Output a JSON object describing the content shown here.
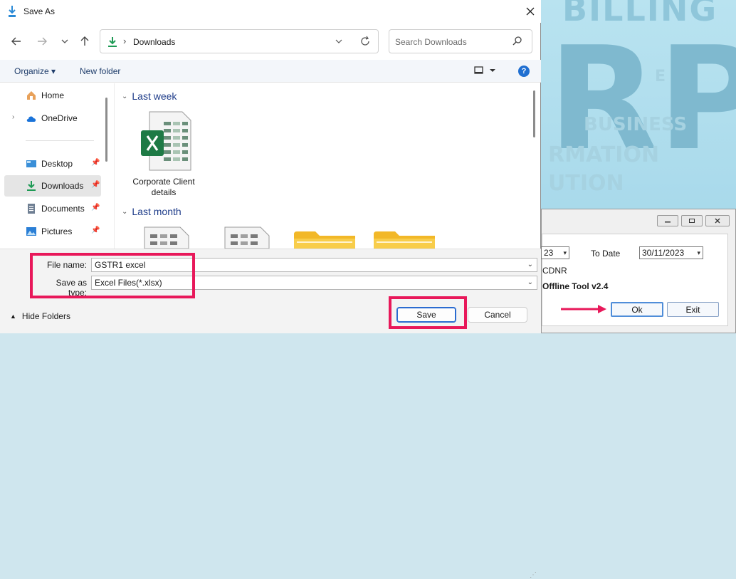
{
  "dialog": {
    "title": "Save As",
    "address": {
      "location": "Downloads"
    },
    "search": {
      "placeholder": "Search Downloads"
    },
    "toolbar": {
      "organize_label": "Organize ▾",
      "new_folder_label": "New folder"
    },
    "sidebar": {
      "items": [
        {
          "label": "Home",
          "icon": "home-icon"
        },
        {
          "label": "OneDrive",
          "icon": "cloud-icon"
        },
        {
          "label": "Desktop",
          "icon": "desktop-icon",
          "pinned": true
        },
        {
          "label": "Downloads",
          "icon": "download-icon",
          "pinned": true,
          "selected": true
        },
        {
          "label": "Documents",
          "icon": "document-icon",
          "pinned": true
        },
        {
          "label": "Pictures",
          "icon": "picture-icon",
          "pinned": true
        }
      ]
    },
    "groups": [
      {
        "label": "Last week",
        "files": [
          {
            "name": "Corporate Client details",
            "icon": "excel-file-icon"
          }
        ]
      },
      {
        "label": "Last month",
        "files": []
      }
    ],
    "form": {
      "filename_label": "File name:",
      "filename_value": "GSTR1 excel",
      "savetype_label": "Save as type:",
      "savetype_value": "Excel Files(*.xlsx)",
      "hide_folders_label": "Hide Folders",
      "save_label": "Save",
      "cancel_label": "Cancel"
    },
    "highlight_color": "#e8185a"
  },
  "background_app": {
    "brand_text": "BILLING",
    "logo_text": "RP",
    "fragments": [
      "E",
      "BUSINESS",
      "RMATION",
      "UTION"
    ],
    "to_date_label": "To Date",
    "from_date_value": "23",
    "to_date_value": "30/11/2023",
    "cdnr_label": "CDNR",
    "tool_label": "Offline Tool v2.4",
    "ok_label": "Ok",
    "exit_label": "Exit"
  }
}
